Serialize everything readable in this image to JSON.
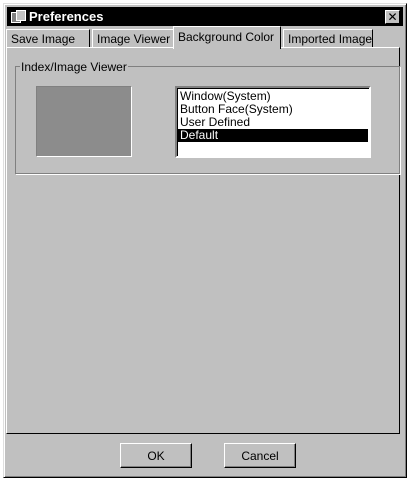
{
  "window": {
    "title": "Preferences",
    "close_glyph": "✕"
  },
  "tabs": [
    {
      "label": "Save Image",
      "active": false
    },
    {
      "label": "Image Viewer",
      "active": false
    },
    {
      "label": "Background Color",
      "active": true
    },
    {
      "label": "Imported Image",
      "active": false
    }
  ],
  "panel": {
    "group_label": "Index/Image Viewer",
    "swatch_color": "#8c8c8c",
    "list_items": [
      "Window(System)",
      "Button Face(System)",
      "User Defined",
      "Default"
    ],
    "selected_item": "Default"
  },
  "footer": {
    "ok_label": "OK",
    "cancel_label": "Cancel"
  },
  "colors": {
    "face": "#c0c0c0",
    "titlebar": "#000000",
    "selection": "#000000"
  }
}
